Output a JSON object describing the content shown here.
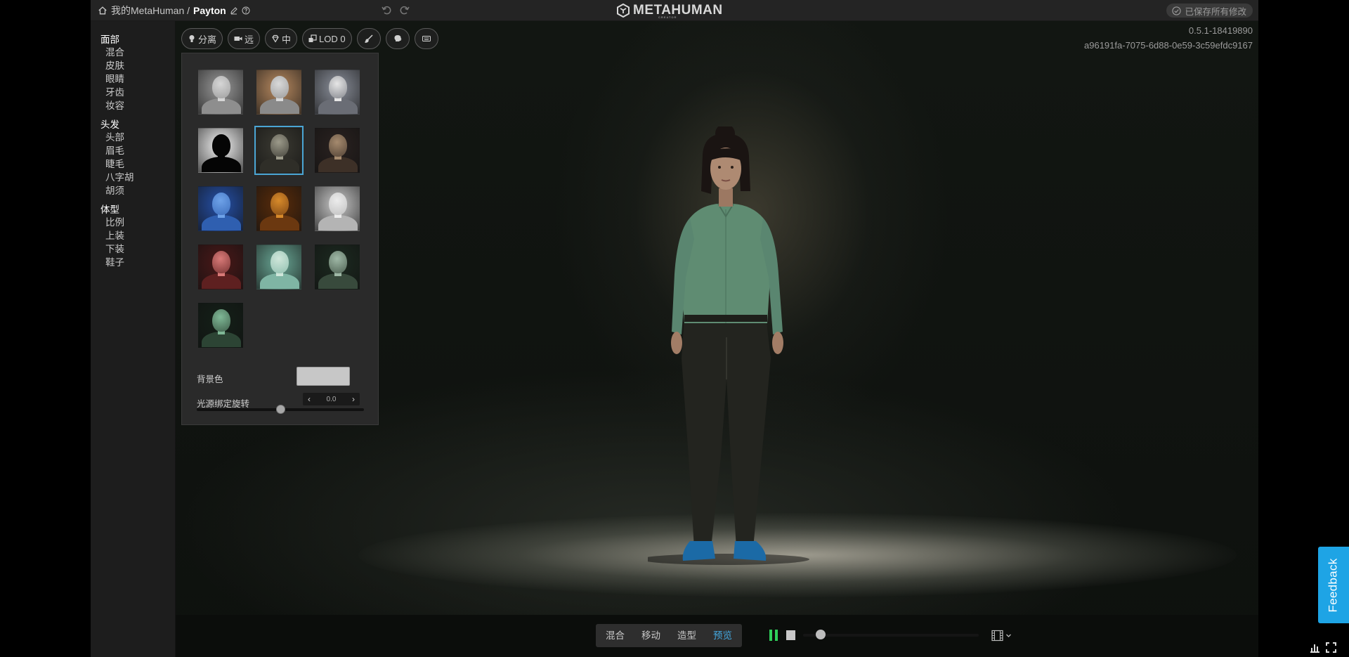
{
  "breadcrumb": {
    "home_label": "我的MetaHuman /",
    "current": "Payton"
  },
  "logo": {
    "text": "METAHUMAN",
    "sub": "CREATOR"
  },
  "save_status": "已保存所有修改",
  "version": {
    "build": "0.5.1-18419890",
    "id": "a96191fa-7075-6d88-0e59-3c59efdc9167"
  },
  "nav": [
    {
      "header": "面部",
      "items": [
        "混合",
        "皮肤",
        "眼睛",
        "牙齿",
        "妆容"
      ]
    },
    {
      "header": "头发",
      "items": [
        "头部",
        "眉毛",
        "睫毛",
        "八字胡",
        "胡须"
      ]
    },
    {
      "header": "体型",
      "items": [
        "比例",
        "上装",
        "下装",
        "鞋子"
      ]
    }
  ],
  "toolbar": {
    "light_label": "分离",
    "camera_label": "远",
    "quality_label": "中",
    "lod_label": "LOD 0"
  },
  "light_panel": {
    "presets": [
      {
        "bg": "#9a9a9a",
        "head": "#d6d6d6",
        "body": "#8e8e8e"
      },
      {
        "bg": "#b88a60",
        "head": "#d9d9d9",
        "body": "#8a8a8a"
      },
      {
        "bg": "#8a8f9a",
        "head": "#e6e6e6",
        "body": "#6a6d75"
      },
      {
        "bg": "#f4f4f4",
        "head": "#050505",
        "body": "#050505"
      },
      {
        "bg": "#3b3a32",
        "head": "#9c9a8a",
        "body": "#2f2e28"
      },
      {
        "bg": "#2a2220",
        "head": "#a58a6e",
        "body": "#3d3027"
      },
      {
        "bg": "#2550a8",
        "head": "#6ea2e8",
        "body": "#2f5fb0"
      },
      {
        "bg": "#5a2c0a",
        "head": "#d78a2a",
        "body": "#6b3810"
      },
      {
        "bg": "#c8c8c8",
        "head": "#ececec",
        "body": "#b4b4b4"
      },
      {
        "bg": "#4a1818",
        "head": "#d87a78",
        "body": "#5e2020"
      },
      {
        "bg": "#6aa896",
        "head": "#cfe6da",
        "body": "#7fb5a4"
      },
      {
        "bg": "#1c2a20",
        "head": "#9fb8a6",
        "body": "#384a3c"
      },
      {
        "bg": "#142018",
        "head": "#7fb896",
        "body": "#2c4434"
      }
    ],
    "selected_index": 4,
    "background_color_label": "背景色",
    "background_color": "#c7c7c7",
    "rotation_label": "光源绑定旋转",
    "rotation_value": "0.0",
    "rotation_fraction": 0.5
  },
  "modes": [
    "混合",
    "移动",
    "造型",
    "预览"
  ],
  "active_mode": 3,
  "playback": {
    "progress": 0.1
  },
  "feedback_label": "Feedback",
  "colors": {
    "accent": "#44a8e0",
    "play": "#2fd05a",
    "feedback": "#1ea4e5"
  }
}
